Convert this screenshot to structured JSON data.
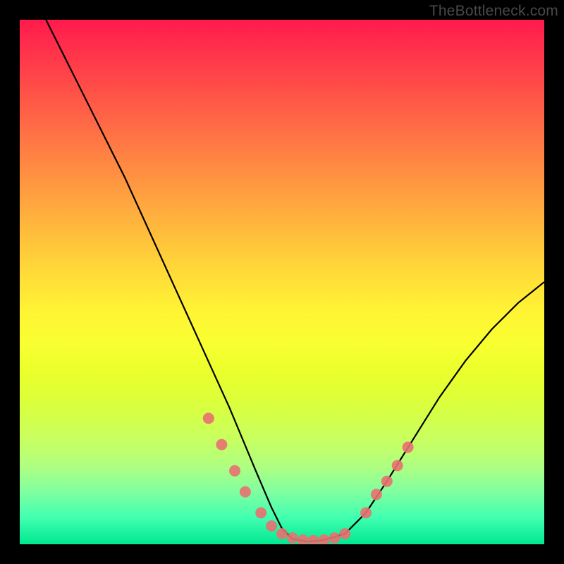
{
  "watermark": "TheBottleneck.com",
  "chart_data": {
    "type": "line",
    "title": "",
    "xlabel": "",
    "ylabel": "",
    "xlim": [
      0,
      100
    ],
    "ylim": [
      0,
      100
    ],
    "series": [
      {
        "name": "curve",
        "x": [
          5,
          10,
          15,
          20,
          25,
          30,
          35,
          40,
          45,
          48,
          50,
          52,
          55,
          58,
          62,
          66,
          70,
          75,
          80,
          85,
          90,
          95,
          100
        ],
        "values": [
          100,
          90,
          80,
          70,
          59,
          48,
          37,
          26,
          14,
          7,
          3,
          1,
          0.5,
          0.8,
          2,
          6,
          12,
          20,
          28,
          35,
          41,
          46,
          50
        ]
      }
    ],
    "markers": {
      "name": "highlight-points",
      "x": [
        36,
        38.5,
        41,
        43,
        46,
        48,
        50,
        52,
        54,
        56,
        58,
        60,
        62,
        66,
        68,
        70,
        72,
        74
      ],
      "values": [
        24,
        19,
        14,
        10,
        6,
        3.5,
        2,
        1.2,
        0.8,
        0.7,
        0.8,
        1.2,
        2,
        6,
        9.5,
        12,
        15,
        18.5
      ]
    },
    "gradient_colors": {
      "top": "#ff1a4d",
      "mid": "#fff534",
      "bottom": "#00e890"
    }
  }
}
